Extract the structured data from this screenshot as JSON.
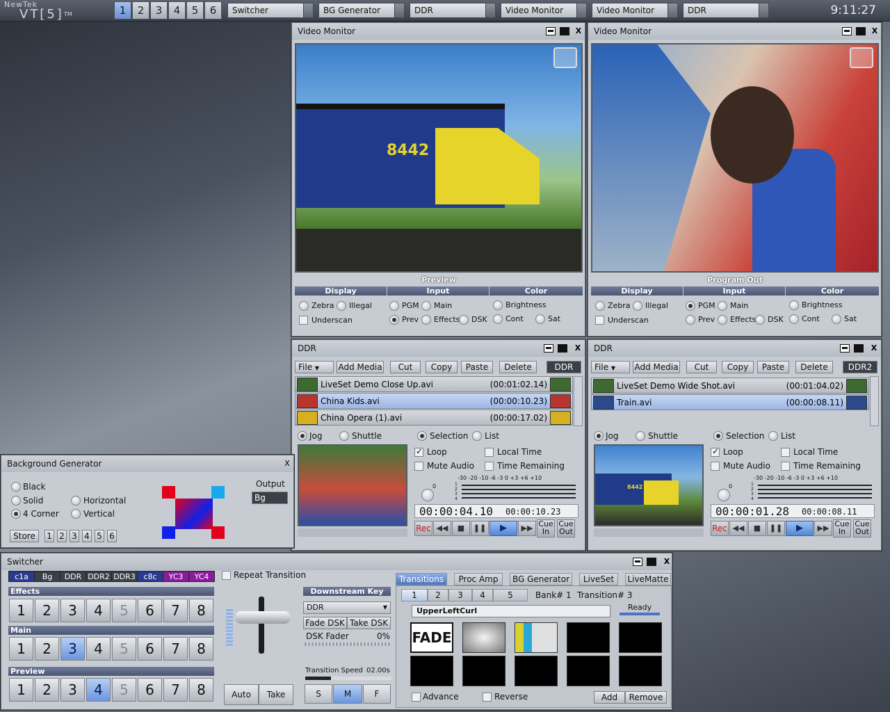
{
  "topbar": {
    "logo_top": "NewTek",
    "logo_main": "VT[5]",
    "logo_tm": "TM",
    "workspaces": [
      "1",
      "2",
      "3",
      "4",
      "5",
      "6"
    ],
    "active_workspace": "1",
    "tasks": [
      "Switcher",
      "BG Generator",
      "DDR",
      "Video Monitor",
      "Video Monitor",
      "DDR"
    ],
    "clock": "9:11:27"
  },
  "vm1": {
    "title": "Video Monitor",
    "label": "Preview",
    "display": "Display",
    "input": "Input",
    "color": "Color",
    "zebra": "Zebra",
    "illegal": "Illegal",
    "underscan": "Underscan",
    "pgm": "PGM",
    "main": "Main",
    "prev": "Prev",
    "effects": "Effects",
    "dsk": "DSK",
    "brightness": "Brightness",
    "cont": "Cont",
    "sat": "Sat",
    "loco_number": "8442"
  },
  "vm2": {
    "title": "Video Monitor",
    "label": "Program Out",
    "display": "Display",
    "input": "Input",
    "color": "Color",
    "zebra": "Zebra",
    "illegal": "Illegal",
    "underscan": "Underscan",
    "pgm": "PGM",
    "main": "Main",
    "prev": "Prev",
    "effects": "Effects",
    "dsk": "DSK",
    "brightness": "Brightness",
    "cont": "Cont",
    "sat": "Sat"
  },
  "ddr1": {
    "title": "DDR",
    "menu": [
      "File",
      "Add Media",
      "Cut",
      "Copy",
      "Paste",
      "Delete"
    ],
    "badge": "DDR",
    "files": [
      {
        "name": "LiveSet Demo Close Up.avi",
        "time": "(00:01:02.14)"
      },
      {
        "name": "China Kids.avi",
        "time": "(00:00:10.23)"
      },
      {
        "name": "China Opera (1).avi",
        "time": "(00:00:17.02)"
      }
    ],
    "jog": "Jog",
    "shuttle": "Shuttle",
    "selection": "Selection",
    "list": "List",
    "loop": "Loop",
    "local_time": "Local Time",
    "mute_audio": "Mute Audio",
    "time_remaining": "Time Remaining",
    "scale": "-30  -20   -10 -6 -3 0 +3 +6  +10",
    "scale_side": "0",
    "vu_side": "1 2 3 4",
    "timecode": "00:00:04.10",
    "duration": "00:00:10.23",
    "rec": "Rec",
    "cue_in": "Cue\nIn",
    "cue_out": "Cue\nOut"
  },
  "ddr2": {
    "title": "DDR",
    "menu": [
      "File",
      "Add Media",
      "Cut",
      "Copy",
      "Paste",
      "Delete"
    ],
    "badge": "DDR2",
    "files": [
      {
        "name": "LiveSet Demo Wide Shot.avi",
        "time": "(00:01:04.02)"
      },
      {
        "name": "Train.avi",
        "time": "(00:00:08.11)"
      }
    ],
    "jog": "Jog",
    "shuttle": "Shuttle",
    "selection": "Selection",
    "list": "List",
    "loop": "Loop",
    "local_time": "Local Time",
    "mute_audio": "Mute Audio",
    "time_remaining": "Time Remaining",
    "scale": "-30  -20   -10 -6 -3 0 +3 +6  +10",
    "scale_side": "0",
    "vu_side": "1 2 3 4",
    "timecode": "00:00:01.28",
    "duration": "00:00:08.11",
    "rec": "Rec",
    "cue_in": "Cue\nIn",
    "cue_out": "Cue\nOut",
    "loco_number": "8442"
  },
  "bg": {
    "title": "Background Generator",
    "close": "X",
    "black": "Black",
    "solid": "Solid",
    "four_corner": "4 Corner",
    "horizontal": "Horizontal",
    "vertical": "Vertical",
    "output_label": "Output",
    "output_value": "Bg",
    "store": "Store",
    "banks": [
      "1",
      "2",
      "3",
      "4",
      "5",
      "6"
    ],
    "colors": {
      "tl": "#e3001a",
      "tr": "#18a8f0",
      "bl": "#1020e8",
      "br": "#e3001a"
    }
  },
  "switcher": {
    "title": "Switcher",
    "sources": [
      "c1a",
      "Bg",
      "DDR",
      "DDR2",
      "DDR3",
      "c8c",
      "YC3",
      "YC4"
    ],
    "repeat": "Repeat Transition",
    "effects_label": "Effects",
    "main_label": "Main",
    "preview_label": "Preview",
    "nums": [
      "1",
      "2",
      "3",
      "4",
      "5",
      "6",
      "7",
      "8"
    ],
    "main_active": "3",
    "preview_active": "4",
    "auto": "Auto",
    "take": "Take",
    "dsk_header": "Downstream Key",
    "dsk_source": "DDR",
    "fade_dsk": "Fade DSK",
    "take_dsk": "Take DSK",
    "dsk_fader": "DSK Fader",
    "dsk_fader_value": "0%",
    "trans_speed": "Transition Speed",
    "trans_speed_value": "02.00s",
    "speed": [
      "S",
      "M",
      "F"
    ],
    "tabs": [
      "Transitions",
      "Proc Amp",
      "BG Generator",
      "LiveSet",
      "LiveMatte"
    ],
    "bank_tabs": [
      "1",
      "2",
      "3",
      "4",
      "5"
    ],
    "bank_info": "Bank#  1",
    "trans_info": "Transition#  3",
    "trans_name": "UpperLeftCurl",
    "ready": "Ready",
    "fade": "FADE",
    "advance": "Advance",
    "reverse": "Reverse",
    "add": "Add",
    "remove": "Remove"
  }
}
